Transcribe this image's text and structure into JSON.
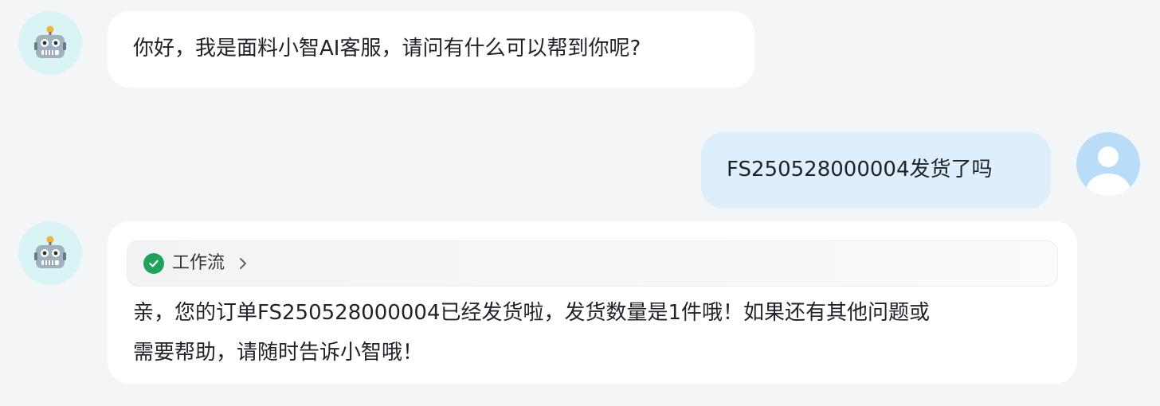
{
  "messages": {
    "greeting": "你好，我是面料小智AI客服，请问有什么可以帮到你呢?",
    "user_question": "FS250528000004发货了吗",
    "workflow_label": "工作流",
    "answer_line1": "亲，您的订单FS250528000004已经发货啦，发货数量是1件哦！如果还有其他问题或",
    "answer_line2": "需要帮助，请随时告诉小智哦！"
  },
  "icons": {
    "bot": "robot-icon",
    "user": "user-icon",
    "workflow_status": "check-circle-icon",
    "workflow_expand": "chevron-right-icon"
  },
  "colors": {
    "background": "#f4f5f7",
    "bot_bubble": "#ffffff",
    "user_bubble": "#ddeefd",
    "success": "#1fa35b"
  }
}
